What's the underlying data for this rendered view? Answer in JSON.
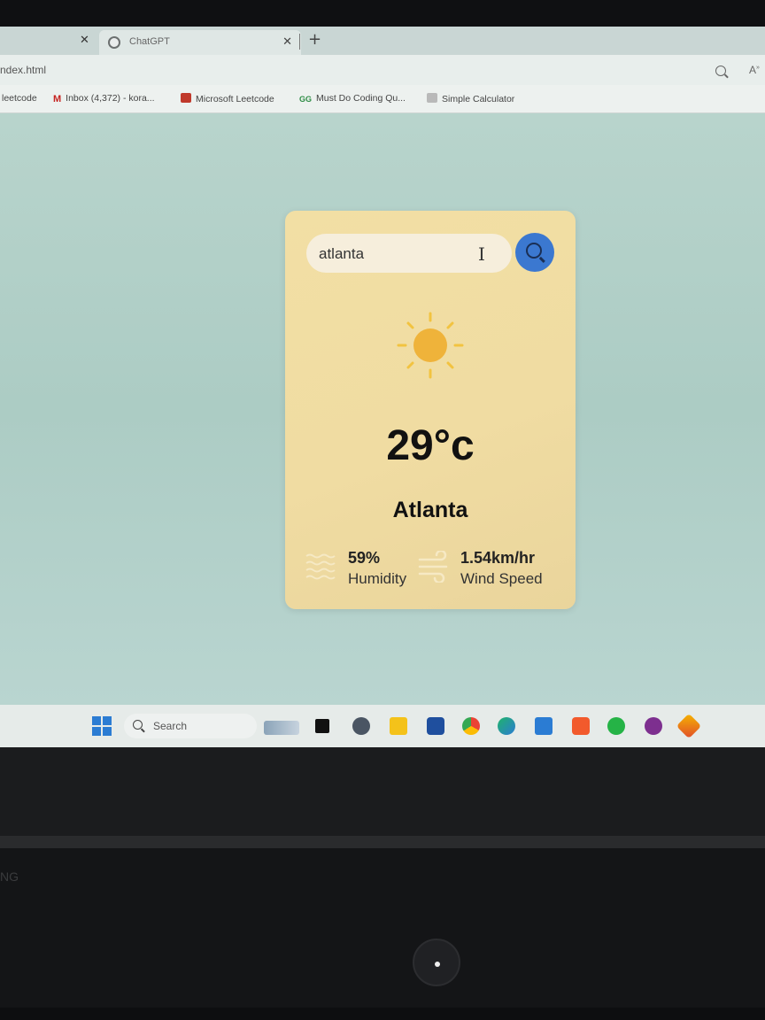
{
  "browser": {
    "tabs": [
      {
        "title": "ChatGPT"
      }
    ],
    "url": "ndex.html",
    "bookmarks": [
      {
        "label": "leetcode"
      },
      {
        "label": "Inbox (4,372) - kora..."
      },
      {
        "label": "Microsoft Leetcode"
      },
      {
        "label": "Must Do Coding Qu..."
      },
      {
        "label": "Simple Calculator"
      }
    ],
    "read_aloud_label": "A"
  },
  "weather": {
    "search_value": "atlanta",
    "temperature": "29°c",
    "city": "Atlanta",
    "humidity_value": "59%",
    "humidity_label": "Humidity",
    "wind_value": "1.54km/hr",
    "wind_label": "Wind Speed",
    "condition_icon": "sun-icon"
  },
  "taskbar": {
    "search_label": "Search"
  },
  "laptop": {
    "brand_partial": "NG"
  },
  "colors": {
    "card_bg": "#f0dca2",
    "search_button": "#3b78d0",
    "sun": "#f0b63a",
    "page_bg": "#b8d4cc"
  }
}
